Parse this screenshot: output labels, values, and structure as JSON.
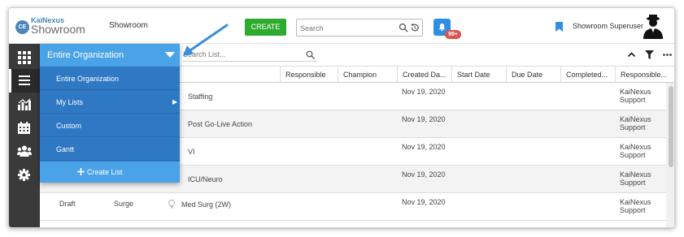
{
  "header": {
    "logo_badge": "CE",
    "logo_brand": "KaiNexus",
    "logo_product": "Showroom",
    "page_title": "Showroom",
    "create_label": "CREATE",
    "search_placeholder": "Search",
    "notification_count": "99+",
    "user_name": "Showroom Superuser"
  },
  "sidebar": {
    "items": [
      {
        "icon": "apps-grid-icon"
      },
      {
        "icon": "list-icon",
        "active": true
      },
      {
        "icon": "chart-icon"
      },
      {
        "icon": "calendar-icon"
      },
      {
        "icon": "people-icon"
      },
      {
        "icon": "gear-icon"
      }
    ]
  },
  "dropdown": {
    "selected": "Entire Organization",
    "items": [
      "Entire Organization",
      "My Lists",
      "Custom",
      "Gantt"
    ],
    "create_label": "Create List"
  },
  "list": {
    "search_placeholder": "Search List...",
    "columns": [
      "Responsible",
      "Champion",
      "Created Da...",
      "Start Date",
      "Due Date",
      "Completed...",
      "Responsible..."
    ],
    "rows": [
      {
        "status": "",
        "type": "",
        "name": "Staffing",
        "created": "Nov 19, 2020",
        "resp1": "KaiNexus",
        "resp2": "Support"
      },
      {
        "status": "",
        "type": "",
        "name": "Post Go-Live Action",
        "created": "Nov 19, 2020",
        "resp1": "KaiNexus",
        "resp2": "Support"
      },
      {
        "status": "",
        "type": "",
        "name": "VI",
        "created": "Nov 19, 2020",
        "resp1": "KaiNexus",
        "resp2": "Support"
      },
      {
        "status": "",
        "type": "",
        "name": "ICU/Neuro",
        "created": "Nov 19, 2020",
        "resp1": "KaiNexus",
        "resp2": "Support"
      },
      {
        "status": "Draft",
        "type": "Surge",
        "name": "Med Surg (2W)",
        "created": "Nov 19, 2020",
        "resp1": "KaiNexus",
        "resp2": "Support"
      }
    ]
  },
  "colors": {
    "create_green": "#2eab2e",
    "dropdown_blue": "#2f78c4",
    "dropdown_header_blue": "#4aa3e6",
    "notification_blue": "#2f8de4",
    "arrow_blue": "#3a8fdc"
  }
}
